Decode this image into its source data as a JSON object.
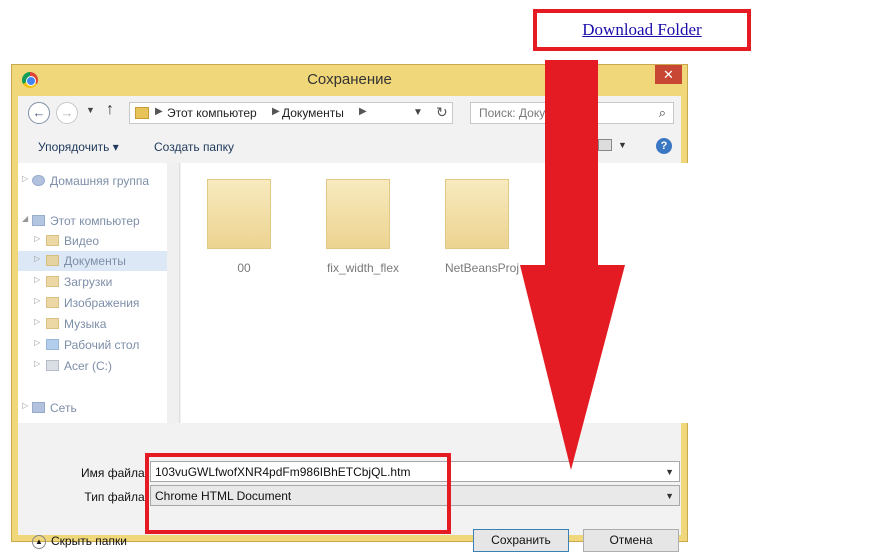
{
  "page_link": {
    "label": "Download Folder"
  },
  "dialog": {
    "title": "Сохранение",
    "close_glyph": "✕",
    "address": {
      "crumb1": "Этот компьютер",
      "crumb2": "Документы"
    },
    "search": {
      "placeholder": "Поиск: Докум"
    },
    "toolbar": {
      "organize": "Упорядочить ▾",
      "new_folder": "Создать папку"
    },
    "nav_items": [
      "Домашняя группа",
      "Этот компьютер",
      "Видео",
      "Документы",
      "Загрузки",
      "Изображения",
      "Музыка",
      "Рабочий стол",
      "Acer (C:)",
      "Сеть"
    ],
    "files": [
      "00",
      "fix_width_flex",
      "NetBeansProj"
    ],
    "filename_label": "Имя файла:",
    "filename_value": "103vuGWLfwofXNR4pdFm986IBhETCbjQL.htm",
    "filetype_label": "Тип файла:",
    "filetype_value": "Chrome HTML Document",
    "hide_folders": "Скрыть папки",
    "save_button": "Сохранить",
    "cancel_button": "Отмена"
  },
  "colors": {
    "annotation_red": "#e41b23",
    "dialog_border": "#f0d77a"
  },
  "icons": [
    "chrome-icon",
    "back-arrow-icon",
    "forward-arrow-icon",
    "up-arrow-icon",
    "refresh-icon",
    "search-icon",
    "help-icon",
    "folder-icon"
  ]
}
